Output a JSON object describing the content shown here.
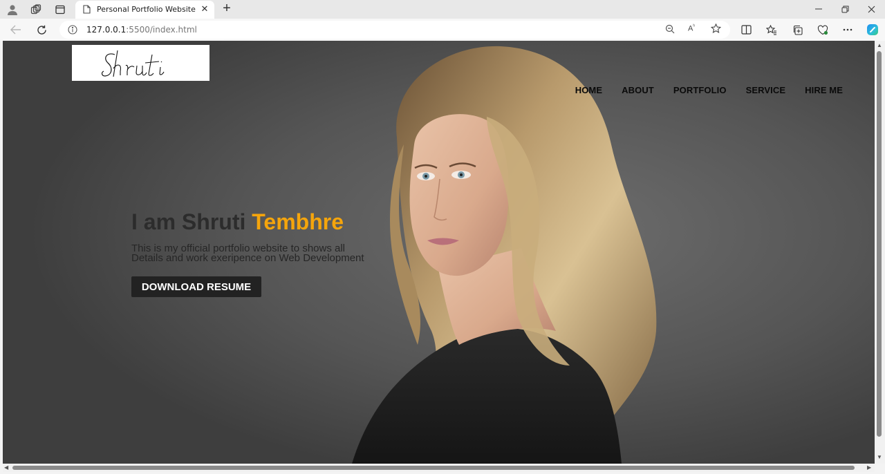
{
  "browser": {
    "tab_title": "Personal Portfolio Website",
    "url_host": "127.0.0.1",
    "url_rest": ":5500/index.html"
  },
  "site": {
    "logo_text": "Shruti",
    "nav": [
      "HOME",
      "ABOUT",
      "PORTFOLIO",
      "SERVICE",
      "HIRE ME"
    ],
    "hero": {
      "title_prefix": "I am Shruti ",
      "title_highlight": "Tembhre",
      "desc_line1": "This is my official portfolio website to shows all",
      "desc_line2": "Details and work exeripence on Web Development",
      "button": "DOWNLOAD RESUME"
    }
  },
  "colors": {
    "highlight": "#f5a50c",
    "button_bg": "#222222"
  }
}
